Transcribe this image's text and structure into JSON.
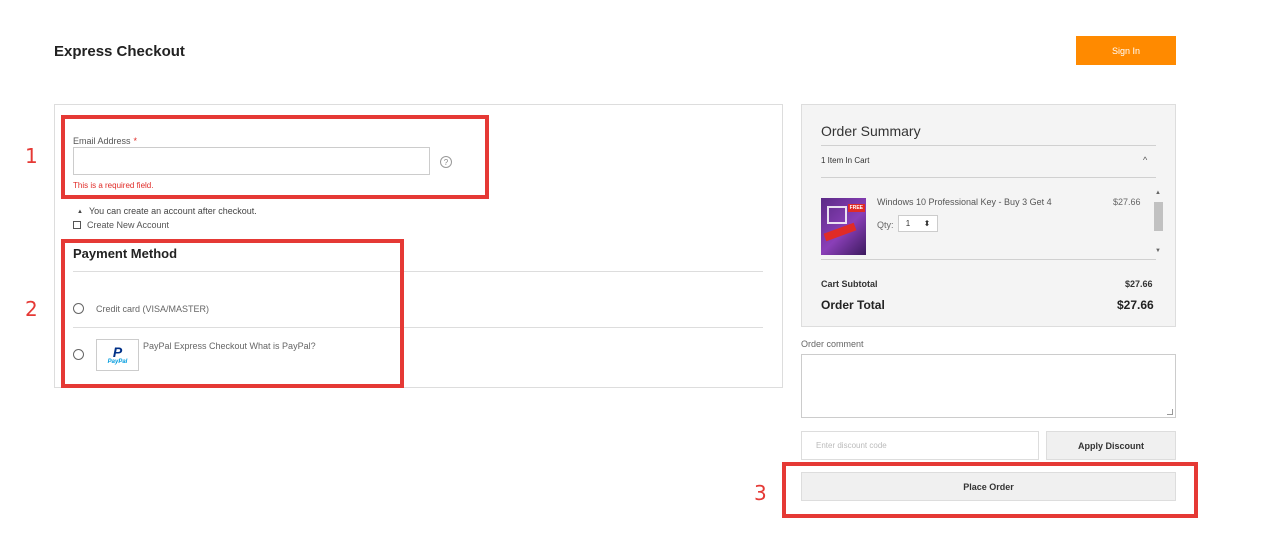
{
  "header": {
    "title": "Express Checkout",
    "sign_in_label": "Sign In"
  },
  "email": {
    "label": "Email Address",
    "required_mark": "*",
    "value": "",
    "help_symbol": "?",
    "error": "This is a required field.",
    "account_note": "You can create an account after checkout.",
    "create_account_label": "Create New Account"
  },
  "payment": {
    "title": "Payment Method",
    "options": [
      {
        "label": "Credit card (VISA/MASTER)"
      },
      {
        "label": "PayPal Express Checkout What is PayPal?",
        "logo_text": "PayPal"
      }
    ]
  },
  "summary": {
    "title": "Order Summary",
    "items_count": "1 Item In Cart",
    "product": {
      "name": "Windows 10 Professional Key - Buy 3 Get 4",
      "price": "$27.66",
      "qty_label": "Qty:",
      "qty": "1",
      "badge": "FREE"
    },
    "subtotal_label": "Cart Subtotal",
    "subtotal": "$27.66",
    "total_label": "Order Total",
    "total": "$27.66"
  },
  "comment": {
    "label": "Order comment"
  },
  "discount": {
    "placeholder": "Enter discount code",
    "apply_label": "Apply Discount"
  },
  "place_order_label": "Place Order",
  "annotations": [
    "1",
    "2",
    "3"
  ],
  "colors": {
    "accent": "#ff8a00",
    "error": "#e02b27",
    "annotation": "#e53935"
  },
  "icons": {
    "help": "question-circle-icon",
    "collapse": "chevron-up-icon",
    "note": "triangle-icon"
  }
}
